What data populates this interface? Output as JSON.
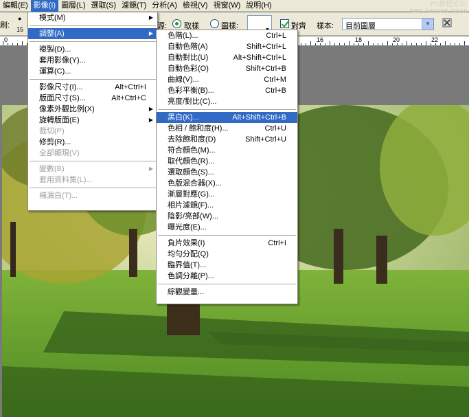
{
  "menubar": {
    "items": [
      {
        "label": "編輯(E)"
      },
      {
        "label": "影像(I)"
      },
      {
        "label": "圖層(L)"
      },
      {
        "label": "選取(S)"
      },
      {
        "label": "濾鏡(T)"
      },
      {
        "label": "分析(A)"
      },
      {
        "label": "檢視(V)"
      },
      {
        "label": "視窗(W)"
      },
      {
        "label": "說明(H)"
      }
    ]
  },
  "watermark": {
    "line1": "PS教程论坛",
    "line2": "BBS.16XX8.COM"
  },
  "options": {
    "brush_label": "刷:",
    "brush_size": "15",
    "source_label": "源:",
    "sampled_label": "取樣",
    "pattern_label": "圖樣:",
    "aligned_label": "對齊",
    "sample_label": "樣本:",
    "sample_value": "目前圖層"
  },
  "ruler": {
    "numbers": [
      "0",
      "16",
      "18",
      "20",
      "22"
    ]
  },
  "image_menu": {
    "items": [
      {
        "label": "模式(M)",
        "submenu": true
      },
      {
        "separator": true
      },
      {
        "label": "調整(A)",
        "submenu": true,
        "selected": true
      },
      {
        "separator": true
      },
      {
        "label": "複製(D)..."
      },
      {
        "label": "套用影像(Y)..."
      },
      {
        "label": "運算(C)..."
      },
      {
        "separator": true
      },
      {
        "label": "影像尺寸(I)...",
        "shortcut": "Alt+Ctrl+I"
      },
      {
        "label": "版面尺寸(S)...",
        "shortcut": "Alt+Ctrl+C"
      },
      {
        "label": "像素外觀比例(X)",
        "submenu": true
      },
      {
        "label": "旋轉版面(E)",
        "submenu": true
      },
      {
        "label": "裁切(P)",
        "disabled": true
      },
      {
        "label": "修剪(R)..."
      },
      {
        "label": "全部顯現(V)",
        "disabled": true
      },
      {
        "separator": true
      },
      {
        "label": "變數(B)",
        "submenu": true,
        "disabled": true
      },
      {
        "label": "套用資料集(L)...",
        "disabled": true
      },
      {
        "separator": true
      },
      {
        "label": "補漏白(T)...",
        "disabled": true
      }
    ]
  },
  "adjust_menu": {
    "items": [
      {
        "label": "色階(L)...",
        "shortcut": "Ctrl+L"
      },
      {
        "label": "自動色階(A)",
        "shortcut": "Shift+Ctrl+L"
      },
      {
        "label": "自動對比(U)",
        "shortcut": "Alt+Shift+Ctrl+L"
      },
      {
        "label": "自動色彩(O)",
        "shortcut": "Shift+Ctrl+B"
      },
      {
        "label": "曲線(V)...",
        "shortcut": "Ctrl+M"
      },
      {
        "label": "色彩平衡(B)...",
        "shortcut": "Ctrl+B"
      },
      {
        "label": "亮度/對比(C)..."
      },
      {
        "separator": true
      },
      {
        "label": "黑白(K)...",
        "shortcut": "Alt+Shift+Ctrl+B",
        "selected": true
      },
      {
        "label": "色相 / 飽和度(H)...",
        "shortcut": "Ctrl+U"
      },
      {
        "label": "去除飽和度(D)",
        "shortcut": "Shift+Ctrl+U"
      },
      {
        "label": "符合顏色(M)..."
      },
      {
        "label": "取代顏色(R)..."
      },
      {
        "label": "選取顏色(S)..."
      },
      {
        "label": "色版混合器(X)..."
      },
      {
        "label": "漸層對應(G)..."
      },
      {
        "label": "相片濾鏡(F)..."
      },
      {
        "label": "陰影/亮部(W)..."
      },
      {
        "label": "曝光度(E)..."
      },
      {
        "separator": true
      },
      {
        "label": "負片效果(I)",
        "shortcut": "Ctrl+I"
      },
      {
        "label": "均勻分配(Q)"
      },
      {
        "label": "臨界值(T)..."
      },
      {
        "label": "色調分離(P)..."
      },
      {
        "separator": true
      },
      {
        "label": "綜觀變量..."
      }
    ]
  },
  "colors": {
    "menu_highlight": "#316ac5",
    "chrome": "#ece9d8",
    "disabled": "#a0a0a0"
  }
}
